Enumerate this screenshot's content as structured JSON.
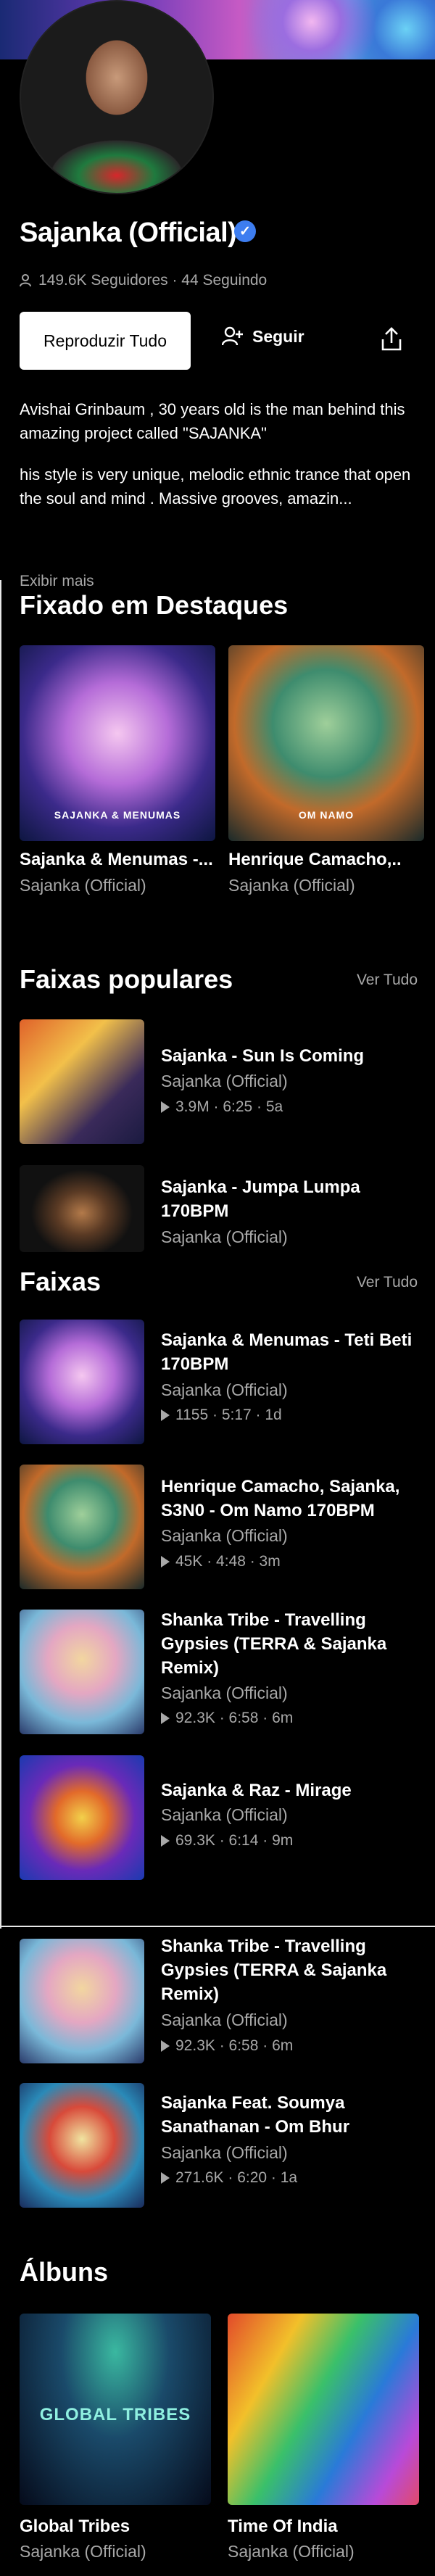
{
  "artist": {
    "name": "Sajanka (Official)",
    "followers_text": "149.6K Seguidores · 44 Seguindo"
  },
  "actions": {
    "play_all": "Reproduzir Tudo",
    "follow": "Seguir"
  },
  "bio": {
    "para1": "Avishai Grinbaum , 30 years old is the man behind this amazing project called \"SAJANKA\"",
    "para2": "his style is very unique, melodic ethnic trance that open the soul and mind . Massive grooves, amazin...",
    "show_more": "Exibir mais"
  },
  "pinned": {
    "title": "Fixado em Destaques",
    "items": [
      {
        "title": "Sajanka & Menumas -...",
        "artist": "Sajanka (Official)",
        "art_label": "SAJANKA & MENUMAS"
      },
      {
        "title": "Henrique Camacho,...",
        "artist": "Sajanka (Official)",
        "art_label": "OM NAMO"
      }
    ]
  },
  "popular": {
    "title": "Faixas populares",
    "see_all": "Ver Tudo",
    "tracks": [
      {
        "title": "Sajanka - Sun Is Coming",
        "artist": "Sajanka (Official)",
        "meta": "3.9M · 6:25 · 5a"
      },
      {
        "title": "Sajanka - Jumpa Lumpa 170BPM",
        "artist": "Sajanka (Official)",
        "meta": ""
      }
    ]
  },
  "tracks": {
    "title": "Faixas",
    "see_all": "Ver Tudo",
    "items": [
      {
        "title": "Sajanka & Menumas - Teti Beti 170BPM",
        "artist": "Sajanka (Official)",
        "meta": "1155 · 5:17 · 1d"
      },
      {
        "title": "Henrique Camacho, Sajanka, S3N0 - Om Namo 170BPM",
        "artist": "Sajanka (Official)",
        "meta": "45K · 4:48 · 3m"
      },
      {
        "title": "Shanka Tribe - Travelling Gypsies (TERRA & Sajanka Remix)",
        "artist": "Sajanka (Official)",
        "meta": "92.3K · 6:58 · 6m"
      },
      {
        "title": "Sajanka & Raz - Mirage",
        "artist": "Sajanka (Official)",
        "meta": "69.3K · 6:14 · 9m"
      },
      {
        "title": "Shanka Tribe - Travelling Gypsies (TERRA & Sajanka Remix)",
        "artist": "Sajanka (Official)",
        "meta": "92.3K · 6:58 · 6m"
      },
      {
        "title": "Sajanka Feat. Soumya Sanathanan - Om Bhur",
        "artist": "Sajanka (Official)",
        "meta": "271.6K · 6:20 · 1a"
      }
    ]
  },
  "albums": {
    "title": "Álbuns",
    "items": [
      {
        "title": "Global Tribes",
        "artist": "Sajanka (Official)",
        "art_label": "GLOBAL TRIBES"
      },
      {
        "title": "Time Of India",
        "artist": "Sajanka (Official)"
      }
    ]
  },
  "colors": {
    "accent_verified": "#3d7df0",
    "muted_text": "#a8a8a8"
  }
}
